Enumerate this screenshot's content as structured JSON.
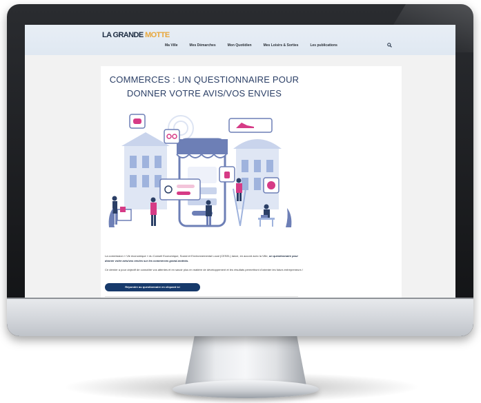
{
  "site": {
    "logo_main": "LA GRANDE",
    "logo_accent": "MOTTE"
  },
  "nav": {
    "items": [
      "Ma Ville",
      "Mes Démarches",
      "Mon Quotidien",
      "Mes Loisirs & Sorties",
      "Les publications"
    ],
    "search_icon": "search-icon"
  },
  "article": {
    "title_line1": "COMMERCES : UN QUESTIONNAIRE POUR",
    "title_line2": "DONNER VOTRE AVIS/VOS ENVIES",
    "intro_prefix": "La commission « Vie économique » du Conseil Economique, Social et Environnemental Local (CESEL) lance, en accord avec la Ville, ",
    "intro_emphasis": "un questionnaire pour donner votre avis/vos envies sur les commerces grand-mottois.",
    "paragraph2": "Ce dernier a pour objectif de connaître vos attentes et en savoir plus en matière de développement et les résultats permettront d'orienter les futurs entrepreneurs !",
    "cta_label": "Répondre au questionnaire en cliquant ici"
  },
  "colors": {
    "title": "#2b3f66",
    "cta_bg": "#173a6b",
    "accent_pink": "#d63b86",
    "accent_blue": "#6d7fb6",
    "header_bg": "#e3ebf4"
  }
}
